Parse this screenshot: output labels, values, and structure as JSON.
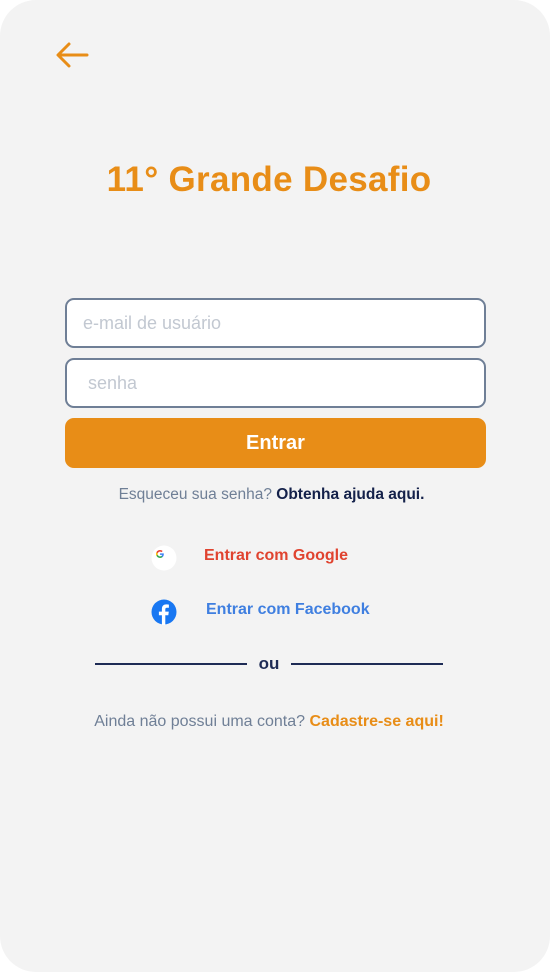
{
  "header": {
    "back_icon": "arrow-left-icon",
    "title": "11° Grande Desafio"
  },
  "form": {
    "email_placeholder": "e-mail de usuário",
    "email_value": "",
    "password_placeholder": "senha",
    "password_value": "",
    "submit_label": "Entrar"
  },
  "forgot": {
    "text": "Esqueceu sua senha?",
    "link": "Obtenha ajuda aqui."
  },
  "social": {
    "google_icon": "google-icon",
    "google_label": "Entrar com Google",
    "facebook_icon": "facebook-icon",
    "facebook_label": "Entrar com Facebook"
  },
  "divider": {
    "label": "ou"
  },
  "signup": {
    "text": "Ainda não possui uma conta?",
    "link": "Cadastre-se aqui!"
  },
  "colors": {
    "accent": "#e88d17",
    "background": "#f3f3f3",
    "navy": "#1e2b55",
    "muted": "#6f7f96",
    "google_red": "#e0432f",
    "facebook_blue": "#3f7fe0",
    "facebook_icon_blue": "#1877f2"
  }
}
